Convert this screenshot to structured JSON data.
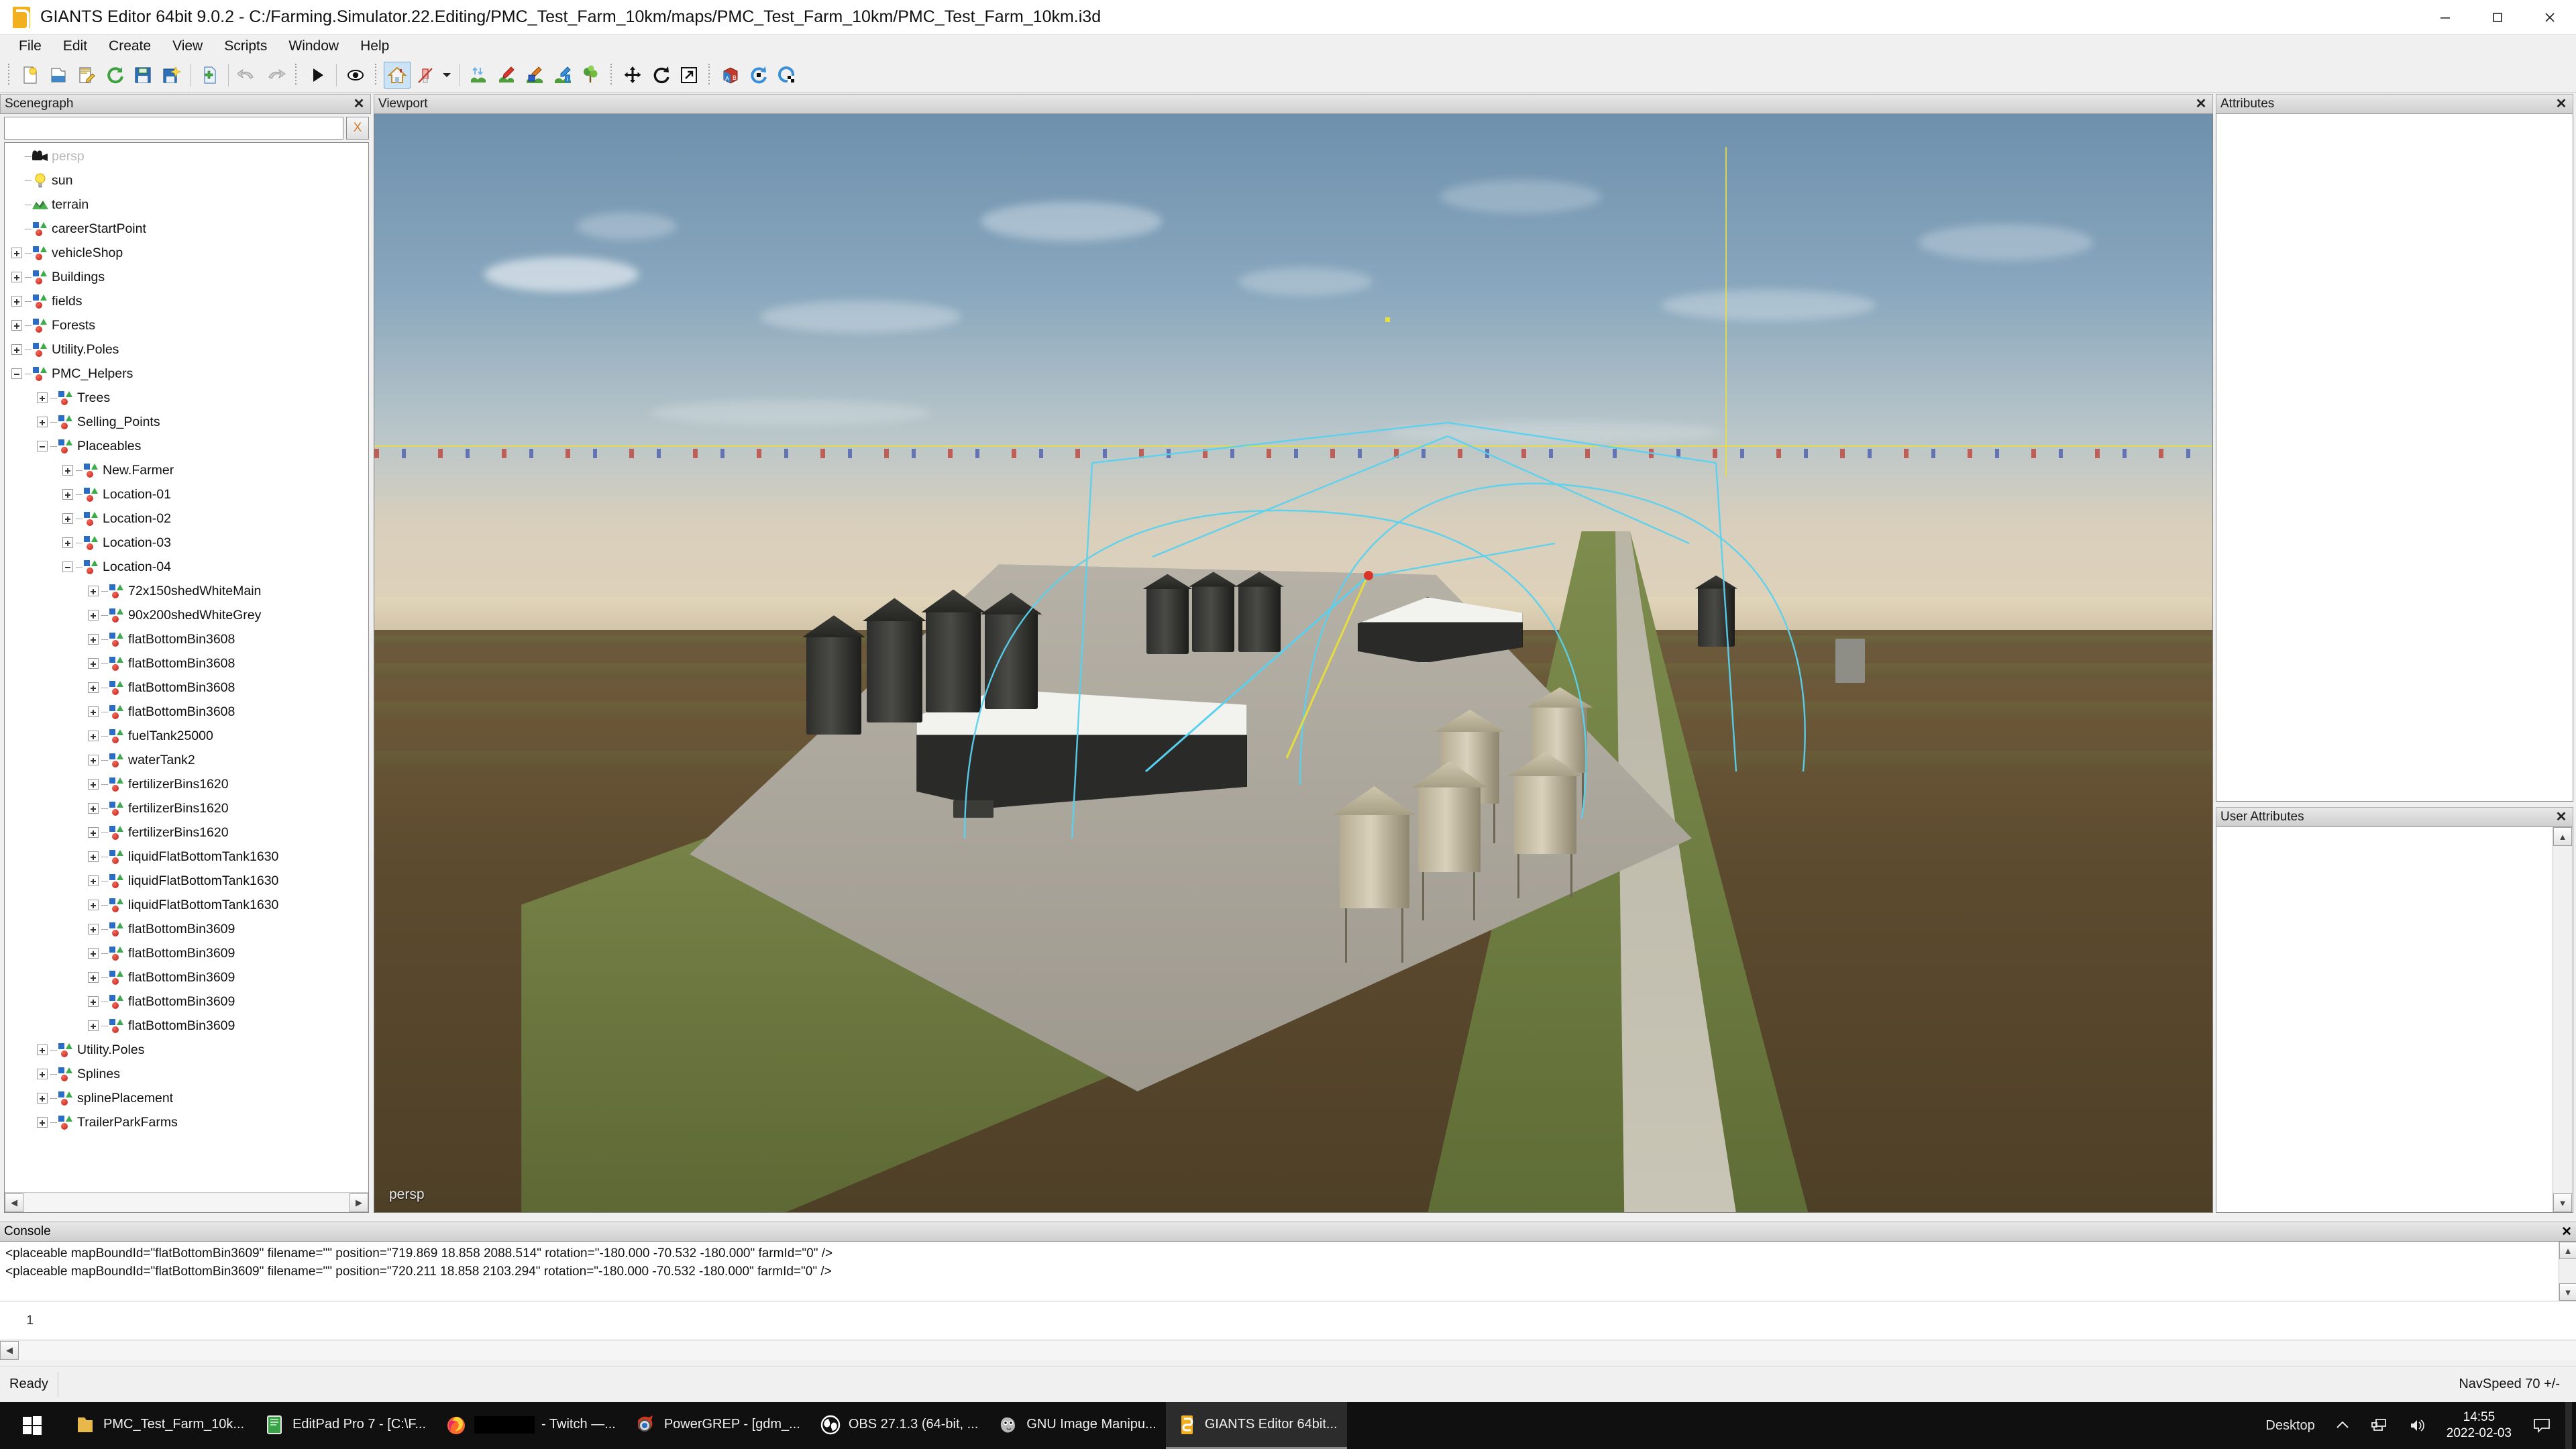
{
  "window": {
    "title": "GIANTS Editor 64bit 9.0.2 - C:/Farming.Simulator.22.Editing/PMC_Test_Farm_10km/maps/PMC_Test_Farm_10km/PMC_Test_Farm_10km.i3d",
    "app_icon": "giants-logo-icon",
    "minimize": "minimize-icon",
    "maximize": "maximize-icon",
    "close": "close-icon"
  },
  "menubar": {
    "items": [
      {
        "label": "File"
      },
      {
        "label": "Edit"
      },
      {
        "label": "Create"
      },
      {
        "label": "View"
      },
      {
        "label": "Scripts"
      },
      {
        "label": "Window"
      },
      {
        "label": "Help"
      }
    ]
  },
  "toolbar": {
    "groups": [
      {
        "icons": [
          "new-file-icon",
          "open-folder-icon",
          "edit-notepad-icon",
          "reload-icon",
          "save-icon",
          "save-as-icon"
        ]
      },
      {
        "icons": [
          "import-file-icon"
        ]
      },
      {
        "icons": [
          "undo-icon",
          "redo-icon"
        ]
      },
      {
        "icons": [
          "play-icon"
        ]
      },
      {
        "icons": [
          "eye-visibility-icon"
        ]
      },
      {
        "icons": [
          "home-terrain-icon",
          "paint-disabled-icon"
        ],
        "caret": "chevron-down-icon"
      },
      {
        "icons": [
          "foliage-raise-icon",
          "foliage-paint-icon",
          "foliage-cube-icon",
          "foliage-info-icon",
          "tree-paint-icon"
        ]
      },
      {
        "icons": [
          "translate-icon",
          "rotate-icon",
          "scale-icon"
        ]
      },
      {
        "icons": [
          "ab-cube-icon",
          "refresh-render-icon",
          "render-checker-icon"
        ]
      }
    ]
  },
  "scenegraph": {
    "title": "Scenegraph",
    "close": "close-icon",
    "search_value": "",
    "search_placeholder": "",
    "clear_label": "X",
    "scroll_left": "◀",
    "scroll_right": "▶",
    "nodes": [
      {
        "label": "persp",
        "depth": 0,
        "expand": "none",
        "icon": "camera-icon",
        "dim": true
      },
      {
        "label": "sun",
        "depth": 0,
        "expand": "none",
        "icon": "light-icon",
        "dim": false
      },
      {
        "label": "terrain",
        "depth": 0,
        "expand": "none",
        "icon": "terrain-icon",
        "dim": false
      },
      {
        "label": "careerStartPoint",
        "depth": 0,
        "expand": "none",
        "icon": "group-icon",
        "dim": false
      },
      {
        "label": "vehicleShop",
        "depth": 0,
        "expand": "plus",
        "icon": "group-icon",
        "dim": false
      },
      {
        "label": "Buildings",
        "depth": 0,
        "expand": "plus",
        "icon": "group-icon",
        "dim": false
      },
      {
        "label": "fields",
        "depth": 0,
        "expand": "plus",
        "icon": "group-icon",
        "dim": false
      },
      {
        "label": "Forests",
        "depth": 0,
        "expand": "plus",
        "icon": "group-icon",
        "dim": false
      },
      {
        "label": "Utility.Poles",
        "depth": 0,
        "expand": "plus",
        "icon": "group-icon",
        "dim": false
      },
      {
        "label": "PMC_Helpers",
        "depth": 0,
        "expand": "minus",
        "icon": "group-icon",
        "dim": false
      },
      {
        "label": "Trees",
        "depth": 1,
        "expand": "plus",
        "icon": "group-icon",
        "dim": false
      },
      {
        "label": "Selling_Points",
        "depth": 1,
        "expand": "plus",
        "icon": "group-icon",
        "dim": false
      },
      {
        "label": "Placeables",
        "depth": 1,
        "expand": "minus",
        "icon": "group-icon",
        "dim": false
      },
      {
        "label": "New.Farmer",
        "depth": 2,
        "expand": "plus",
        "icon": "group-icon",
        "dim": false
      },
      {
        "label": "Location-01",
        "depth": 2,
        "expand": "plus",
        "icon": "group-icon",
        "dim": false
      },
      {
        "label": "Location-02",
        "depth": 2,
        "expand": "plus",
        "icon": "group-icon",
        "dim": false
      },
      {
        "label": "Location-03",
        "depth": 2,
        "expand": "plus",
        "icon": "group-icon",
        "dim": false
      },
      {
        "label": "Location-04",
        "depth": 2,
        "expand": "minus",
        "icon": "group-icon",
        "dim": false
      },
      {
        "label": "72x150shedWhiteMain",
        "depth": 3,
        "expand": "plus",
        "icon": "group-icon",
        "dim": false
      },
      {
        "label": "90x200shedWhiteGrey",
        "depth": 3,
        "expand": "plus",
        "icon": "group-icon",
        "dim": false
      },
      {
        "label": "flatBottomBin3608",
        "depth": 3,
        "expand": "plus",
        "icon": "group-icon",
        "dim": false
      },
      {
        "label": "flatBottomBin3608",
        "depth": 3,
        "expand": "plus",
        "icon": "group-icon",
        "dim": false
      },
      {
        "label": "flatBottomBin3608",
        "depth": 3,
        "expand": "plus",
        "icon": "group-icon",
        "dim": false
      },
      {
        "label": "flatBottomBin3608",
        "depth": 3,
        "expand": "plus",
        "icon": "group-icon",
        "dim": false
      },
      {
        "label": "fuelTank25000",
        "depth": 3,
        "expand": "plus",
        "icon": "group-icon",
        "dim": false
      },
      {
        "label": "waterTank2",
        "depth": 3,
        "expand": "plus",
        "icon": "group-icon",
        "dim": false
      },
      {
        "label": "fertilizerBins1620",
        "depth": 3,
        "expand": "plus",
        "icon": "group-icon",
        "dim": false
      },
      {
        "label": "fertilizerBins1620",
        "depth": 3,
        "expand": "plus",
        "icon": "group-icon",
        "dim": false
      },
      {
        "label": "fertilizerBins1620",
        "depth": 3,
        "expand": "plus",
        "icon": "group-icon",
        "dim": false
      },
      {
        "label": "liquidFlatBottomTank1630",
        "depth": 3,
        "expand": "plus",
        "icon": "group-icon",
        "dim": false
      },
      {
        "label": "liquidFlatBottomTank1630",
        "depth": 3,
        "expand": "plus",
        "icon": "group-icon",
        "dim": false
      },
      {
        "label": "liquidFlatBottomTank1630",
        "depth": 3,
        "expand": "plus",
        "icon": "group-icon",
        "dim": false
      },
      {
        "label": "flatBottomBin3609",
        "depth": 3,
        "expand": "plus",
        "icon": "group-icon",
        "dim": false
      },
      {
        "label": "flatBottomBin3609",
        "depth": 3,
        "expand": "plus",
        "icon": "group-icon",
        "dim": false
      },
      {
        "label": "flatBottomBin3609",
        "depth": 3,
        "expand": "plus",
        "icon": "group-icon",
        "dim": false
      },
      {
        "label": "flatBottomBin3609",
        "depth": 3,
        "expand": "plus",
        "icon": "group-icon",
        "dim": false
      },
      {
        "label": "flatBottomBin3609",
        "depth": 3,
        "expand": "plus",
        "icon": "group-icon",
        "dim": false
      },
      {
        "label": "Utility.Poles",
        "depth": 1,
        "expand": "plus",
        "icon": "group-icon",
        "dim": false
      },
      {
        "label": "Splines",
        "depth": 1,
        "expand": "plus",
        "icon": "group-icon",
        "dim": false
      },
      {
        "label": "splinePlacement",
        "depth": 1,
        "expand": "plus",
        "icon": "group-icon",
        "dim": false
      },
      {
        "label": "TrailerParkFarms",
        "depth": 1,
        "expand": "plus",
        "icon": "group-icon",
        "dim": false
      }
    ]
  },
  "viewport": {
    "title": "Viewport",
    "close": "close-icon",
    "camera_label": "persp"
  },
  "attributes": {
    "title": "Attributes",
    "close": "close-icon"
  },
  "user_attributes": {
    "title": "User Attributes",
    "close": "close-icon"
  },
  "console": {
    "title": "Console",
    "close": "close-icon",
    "lines": [
      "<placeable mapBoundId=\"flatBottomBin3609\" filename=\"\"  position=\"719.869 18.858 2088.514\" rotation=\"-180.000 -70.532 -180.000\" farmId=\"0\" />",
      "<placeable mapBoundId=\"flatBottomBin3609\" filename=\"\"  position=\"720.211 18.858 2103.294\" rotation=\"-180.000 -70.532 -180.000\" farmId=\"0\" />"
    ],
    "prompt_number": "1",
    "input_value": ""
  },
  "statusbar": {
    "left": "Ready",
    "right": "NavSpeed 70 +/-"
  },
  "taskbar": {
    "start": "windows-start-icon",
    "tasks": [
      {
        "label": "PMC_Test_Farm_10k...",
        "icon": "folder-icon",
        "active": false,
        "redacted": false
      },
      {
        "label": "EditPad Pro 7 - [C:\\F...",
        "icon": "editpad-icon",
        "active": false,
        "redacted": false
      },
      {
        "label": "- Twitch —...",
        "icon": "firefox-icon",
        "active": false,
        "redacted": true
      },
      {
        "label": "PowerGREP - [gdm_...",
        "icon": "powergrep-icon",
        "active": false,
        "redacted": false
      },
      {
        "label": "OBS 27.1.3 (64-bit, ...",
        "icon": "obs-icon",
        "active": false,
        "redacted": false
      },
      {
        "label": "GNU Image Manipu...",
        "icon": "gimp-icon",
        "active": false,
        "redacted": false
      },
      {
        "label": "GIANTS Editor 64bit...",
        "icon": "giants-logo-icon",
        "active": true,
        "redacted": false
      }
    ],
    "tray": {
      "desktop_label": "Desktop",
      "overflow": "chevron-up-icon",
      "network": "network-icon",
      "volume": "volume-icon",
      "time": "14:55",
      "date": "2022-02-03",
      "notifications": "notification-icon"
    }
  },
  "colors": {
    "accent": "#f2b01e",
    "panel": "#f0f0f0",
    "gizmo": "#58d2f0",
    "grid": "#e8e03a"
  }
}
